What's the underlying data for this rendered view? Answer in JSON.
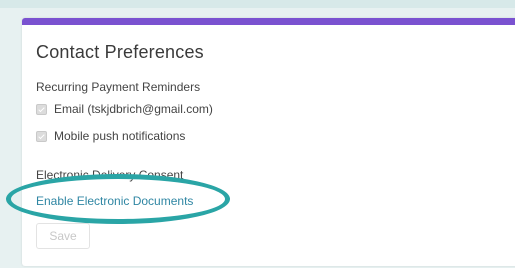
{
  "card": {
    "title": "Contact Preferences",
    "recurring_label": "Recurring Payment Reminders",
    "options": [
      {
        "label": "Email (tskjdbrich@gmail.com)",
        "checked": true,
        "disabled": true
      },
      {
        "label": "Mobile push notifications",
        "checked": true,
        "disabled": true
      }
    ],
    "delivery_label": "Electronic Delivery Consent",
    "enable_link": "Enable Electronic Documents",
    "save_label": "Save"
  },
  "colors": {
    "accent": "#7a52d0",
    "link": "#2f86a3",
    "highlight": "#2aa5a6"
  }
}
